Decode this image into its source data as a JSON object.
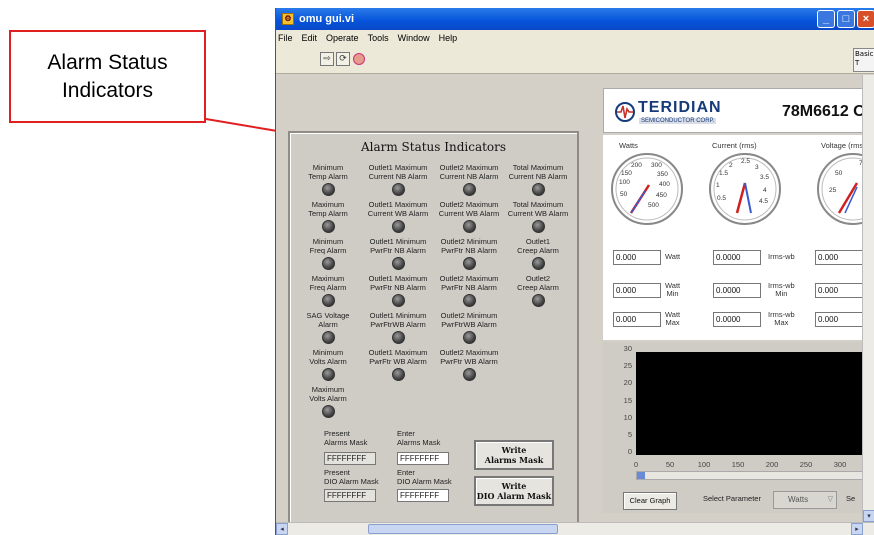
{
  "callout": {
    "text": "Alarm Status\nIndicators",
    "border_color": "#e02020"
  },
  "window": {
    "title": "omu gui.vi",
    "buttons": {
      "minimize": "_",
      "maximize": "□",
      "close": "×"
    }
  },
  "menu": [
    "File",
    "Edit",
    "Operate",
    "Tools",
    "Window",
    "Help"
  ],
  "toolbar": {
    "run_icon": "run-arrow-icon",
    "run_continuous_icon": "run-continuous-icon",
    "abort_icon": "abort-icon",
    "context_help": "Basic\nT"
  },
  "alarm_panel": {
    "title": "Alarm Status Indicators",
    "indicators": [
      {
        "label": "Minimum\nTemp Alarm",
        "col": 0,
        "row": 0
      },
      {
        "label": "Outlet1 Maximum\nCurrent NB Alarm",
        "col": 1,
        "row": 0
      },
      {
        "label": "Outlet2 Maximum\nCurrent NB Alarm",
        "col": 2,
        "row": 0
      },
      {
        "label": "Total Maximum\nCurrent NB Alarm",
        "col": 3,
        "row": 0
      },
      {
        "label": "Maximum\nTemp Alarm",
        "col": 0,
        "row": 1
      },
      {
        "label": "Outlet1 Maximum\nCurrent WB Alarm",
        "col": 1,
        "row": 1
      },
      {
        "label": "Outlet2 Maximum\nCurrent WB Alarm",
        "col": 2,
        "row": 1
      },
      {
        "label": "Total Maximum\nCurrent WB Alarm",
        "col": 3,
        "row": 1
      },
      {
        "label": "Minimum\nFreq Alarm",
        "col": 0,
        "row": 2
      },
      {
        "label": "Outlet1 Minimum\nPwrFtr NB Alarm",
        "col": 1,
        "row": 2
      },
      {
        "label": "Outlet2 Minimum\nPwrFtr NB Alarm",
        "col": 2,
        "row": 2
      },
      {
        "label": "Outlet1\nCreep Alarm",
        "col": 3,
        "row": 2
      },
      {
        "label": "Maximum\nFreq Alarm",
        "col": 0,
        "row": 3
      },
      {
        "label": "Outlet1 Maximum\nPwrFtr NB Alarm",
        "col": 1,
        "row": 3
      },
      {
        "label": "Outlet2 Maximum\nPwrFtr NB Alarm",
        "col": 2,
        "row": 3
      },
      {
        "label": "Outlet2\nCreep Alarm",
        "col": 3,
        "row": 3
      },
      {
        "label": "SAG Voltage\nAlarm",
        "col": 0,
        "row": 4
      },
      {
        "label": "Outlet1 Minimum\nPwrFtrWB Alarm",
        "col": 1,
        "row": 4
      },
      {
        "label": "Outlet2 Minimum\nPwrFtrWB Alarm",
        "col": 2,
        "row": 4
      },
      {
        "label": "Minimum\nVolts Alarm",
        "col": 0,
        "row": 5
      },
      {
        "label": "Outlet1 Maximum\nPwrFtr WB Alarm",
        "col": 1,
        "row": 5
      },
      {
        "label": "Outlet2 Maximum\nPwrFtr WB Alarm",
        "col": 2,
        "row": 5
      },
      {
        "label": "Maximum\nVolts Alarm",
        "col": 0,
        "row": 6
      }
    ],
    "masks": {
      "present_alarms_label": "Present\nAlarms Mask",
      "present_alarms_value": "FFFFFFFF",
      "enter_alarms_label": "Enter\nAlarms Mask",
      "enter_alarms_value": "FFFFFFFF",
      "present_dio_label": "Present\nDIO Alarm Mask",
      "present_dio_value": "FFFFFFFF",
      "enter_dio_label": "Enter\nDIO Alarm Mask",
      "enter_dio_value": "FFFFFFFF",
      "write_alarms_button": "Write\nAlarms Mask",
      "write_dio_button": "Write\nDIO Alarm Mask"
    }
  },
  "header": {
    "logo": "TERIDIAN",
    "logo_sub": "SEMICONDUCTOR CORP.",
    "part_number": "78M6612 O",
    "brand_color": "#173b7a"
  },
  "gauges": [
    {
      "title": "Watts",
      "ticks": [
        "100",
        "150",
        "200",
        "300",
        "350",
        "400",
        "450",
        "500",
        "50"
      ],
      "unit": "Watt",
      "value": "0.000",
      "min_unit": "Watt\nMin",
      "min_value": "0.000",
      "max_unit": "Watt\nMax",
      "max_value": "0.000"
    },
    {
      "title": "Current (rms)",
      "ticks": [
        "1",
        "1.5",
        "2",
        "2.5",
        "3",
        "3.5",
        "4",
        "4.5",
        "0.5"
      ],
      "unit": "Irms-wb",
      "value": "0.0000",
      "min_unit": "Irms-wb\nMin",
      "min_value": "0.0000",
      "max_unit": "Irms-wb\nMax",
      "max_value": "0.0000"
    },
    {
      "title": "Voltage (rms)",
      "ticks": [
        "50",
        "75",
        "25"
      ],
      "value": "0.000",
      "min_value": "0.000",
      "max_value": "0.000"
    }
  ],
  "graph": {
    "y_ticks": [
      "30",
      "25",
      "20",
      "15",
      "10",
      "5",
      "0"
    ],
    "x_ticks": [
      "0",
      "50",
      "100",
      "150",
      "200",
      "250",
      "300",
      "350"
    ],
    "clear_button": "Clear Graph",
    "select_label": "Select Parameter",
    "select_value": "Watts",
    "trailing_label": "Se"
  }
}
